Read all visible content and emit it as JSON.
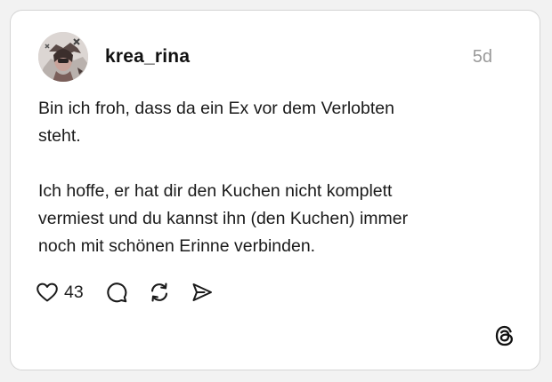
{
  "post": {
    "username": "krea_rina",
    "timestamp": "5d",
    "text": "Bin ich froh, dass da ein Ex vor dem Verlobten\nsteht.\n\nIch hoffe, er hat dir den Kuchen nicht komplett\nvermiest und du kannst ihn (den Kuchen) immer\nnoch mit schönen Erinne verbinden.",
    "like_count": "43"
  },
  "icons": {
    "avatar": "profile-photo",
    "like": "heart-icon",
    "comment": "comment-bubble-icon",
    "repost": "repost-icon",
    "share": "send-icon",
    "brand": "threads-logo-icon"
  },
  "colors": {
    "text": "#111111",
    "muted": "#9a9a9a",
    "border": "#d4d4d4"
  }
}
